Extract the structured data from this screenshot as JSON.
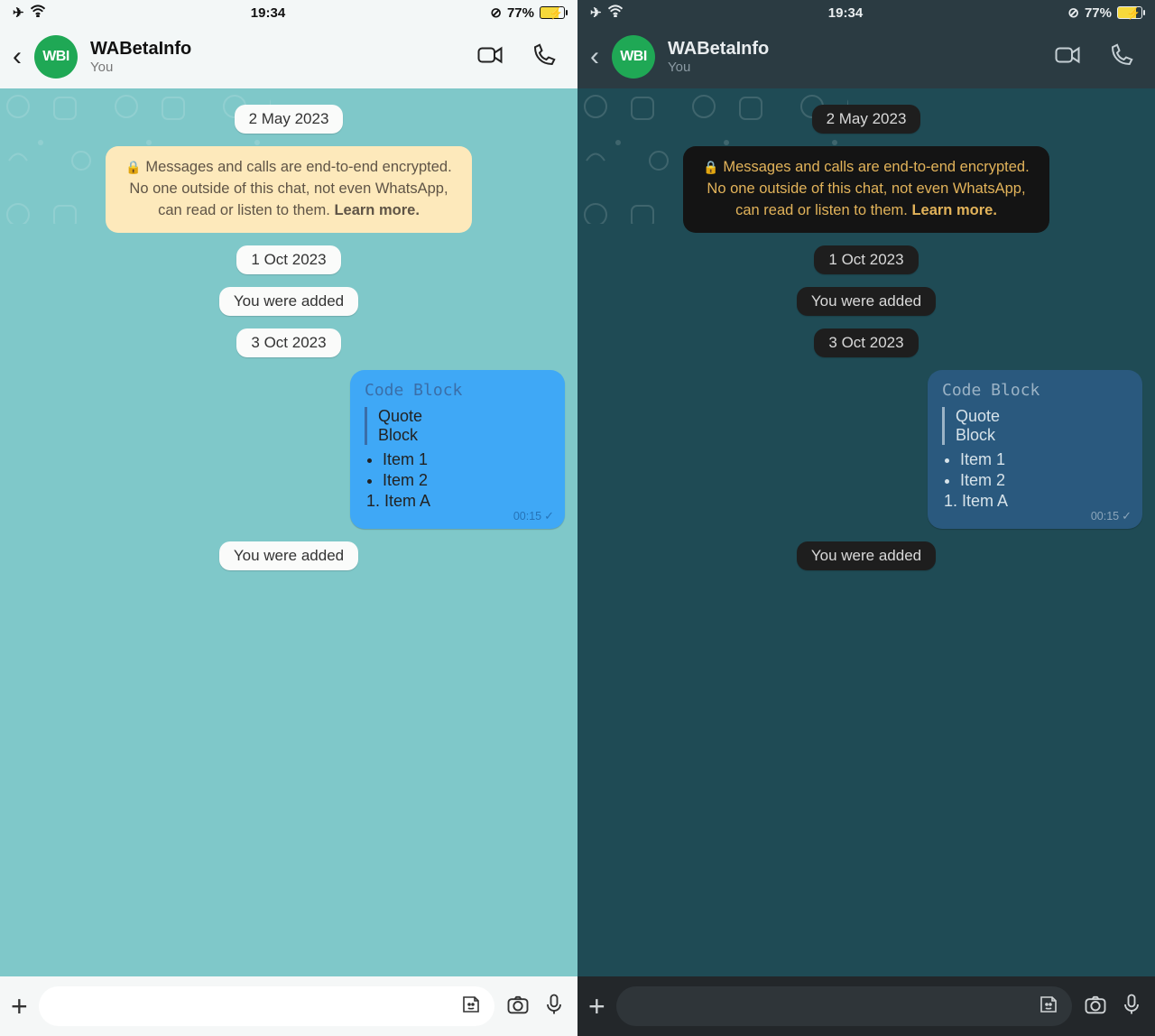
{
  "status": {
    "time": "19:34",
    "battery_pct": "77%"
  },
  "header": {
    "back": "‹",
    "avatar_text": "WBI",
    "title": "WABetaInfo",
    "subtitle": "You"
  },
  "chat": {
    "date1": "2 May 2023",
    "notice_line1": "Messages and calls are end-to-end encrypted.",
    "notice_line2": "No one outside of this chat, not even WhatsApp,",
    "notice_line3": "can read or listen to them.",
    "notice_learn": "Learn more.",
    "date2": "1 Oct 2023",
    "system1": "You were added",
    "date3": "3 Oct 2023",
    "msg": {
      "code": "Code Block",
      "quote_l1": "Quote",
      "quote_l2": "Block",
      "bullet1": "Item 1",
      "bullet2": "Item 2",
      "ordered1": "Item A",
      "time": "00:15"
    },
    "system2": "You were added"
  }
}
